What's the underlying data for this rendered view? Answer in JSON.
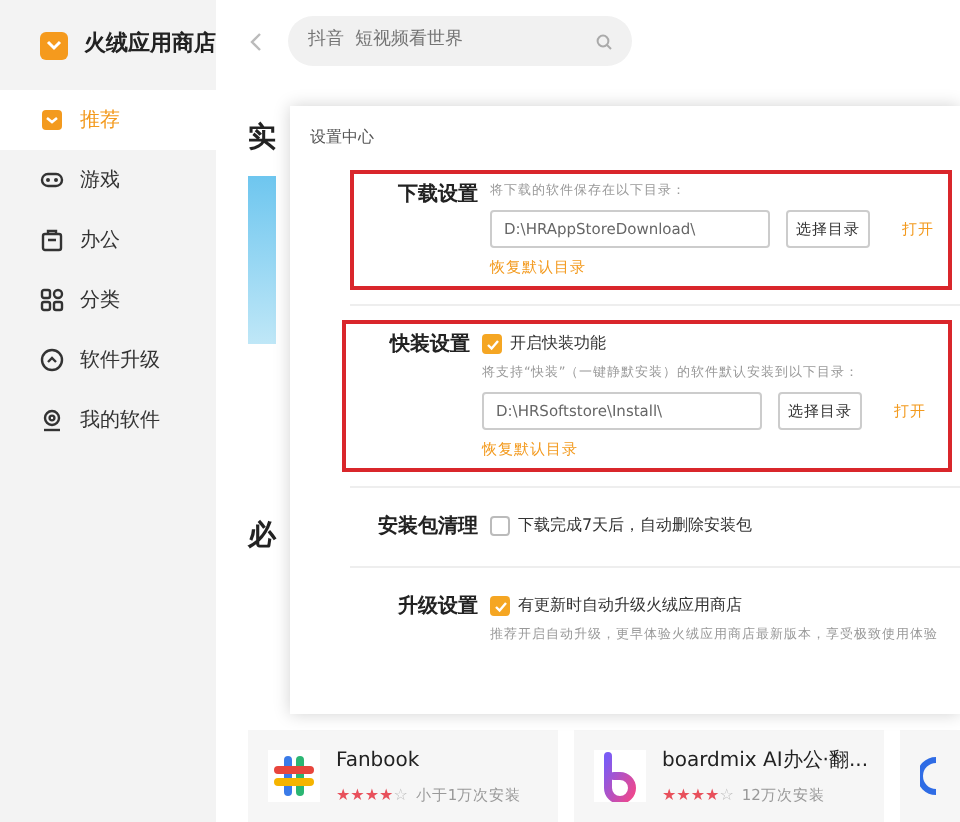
{
  "sidebar": {
    "app_name": "火绒应用商店",
    "items": [
      {
        "label": "推荐",
        "selected": true
      },
      {
        "label": "游戏",
        "selected": false
      },
      {
        "label": "办公",
        "selected": false
      },
      {
        "label": "分类",
        "selected": false
      },
      {
        "label": "软件升级",
        "selected": false
      },
      {
        "label": "我的软件",
        "selected": false
      }
    ]
  },
  "search": {
    "placeholder": "抖音  短视频看世界"
  },
  "page": {
    "heading_1": "实",
    "heading_2": "必"
  },
  "apps": [
    {
      "name": "Fanbook",
      "stars": 4,
      "installs": "小于1万次安装"
    },
    {
      "name": "boardmix AI办公·翻...",
      "stars": 4,
      "installs": "12万次安装"
    }
  ],
  "dialog": {
    "title": "设置中心",
    "sections": [
      {
        "label": "下载设置",
        "highlighted": true,
        "hint": "将下载的软件保存在以下目录：",
        "path": {
          "value": "D:\\HRAppStoreDownload\\",
          "button": "选择目录",
          "open": "打开"
        },
        "reset": "恢复默认目录"
      },
      {
        "label": "快装设置",
        "highlighted": true,
        "option": {
          "label": "开启快装功能",
          "checked": true
        },
        "hint": "将支持“快装”（一键静默安装）的软件默认安装到以下目录：",
        "path": {
          "value": "D:\\HRSoftstore\\Install\\",
          "button": "选择目录",
          "open": "打开"
        },
        "reset": "恢复默认目录"
      },
      {
        "label": "安装包清理",
        "highlighted": false,
        "option": {
          "label": "下载完成7天后，自动删除安装包",
          "checked": false
        }
      },
      {
        "label": "升级设置",
        "highlighted": false,
        "option": {
          "label": "有更新时自动升级火绒应用商店",
          "checked": true
        },
        "note": "推荐开启自动升级，更早体验火绒应用商店最新版本，享受极致使用体验"
      }
    ]
  }
}
